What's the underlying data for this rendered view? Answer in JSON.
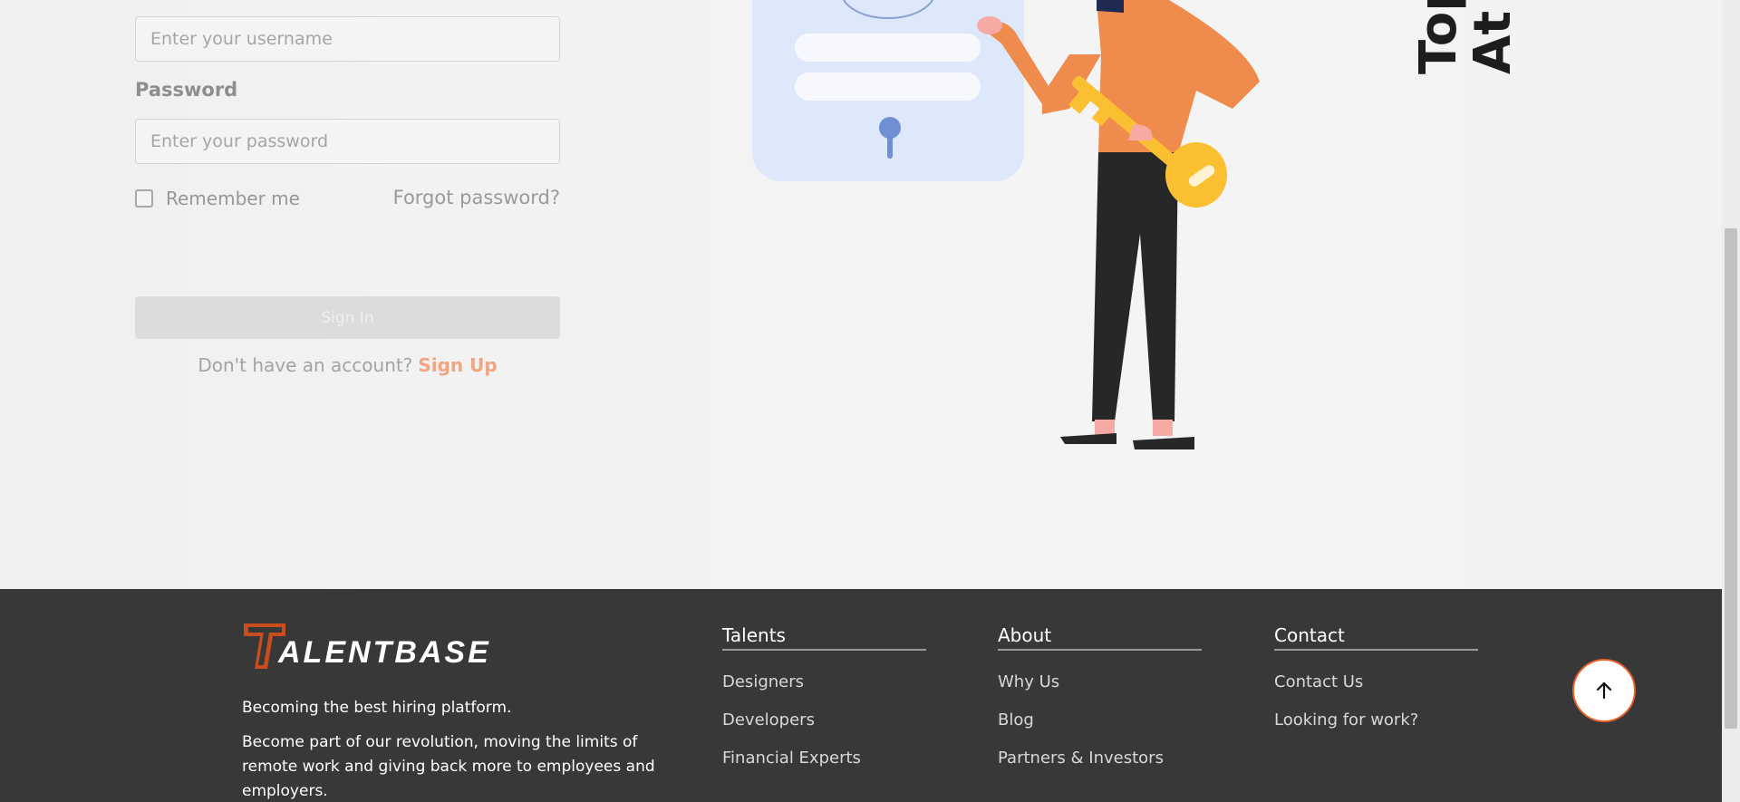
{
  "login_form": {
    "username_placeholder": "Enter your username",
    "password_label": "Password",
    "password_placeholder": "Enter your password",
    "remember_label": "Remember me",
    "forgot_label": "Forgot password?",
    "signin_label": "Sign In",
    "no_account_text": "Don't have an account?",
    "signup_label": "Sign Up"
  },
  "hero": {
    "headline": "Top\nAt C"
  },
  "footer": {
    "logo_text": "ALENTBASE",
    "tagline": "Becoming the best hiring platform.",
    "blurb": "Become part of our revolution, moving the limits of remote work and giving back more to employees and employers.",
    "columns": [
      {
        "title": "Talents",
        "links": [
          "Designers",
          "Developers",
          "Financial Experts"
        ]
      },
      {
        "title": "About",
        "links": [
          "Why Us",
          "Blog",
          "Partners & Investors"
        ]
      },
      {
        "title": "Contact",
        "links": [
          "Contact Us",
          "Looking for work?"
        ]
      }
    ],
    "scroll_top_icon": "arrow-up-icon"
  },
  "colors": {
    "accent": "#e8622a",
    "signup_link": "#f0a583",
    "footer_bg": "#383838",
    "character_top": "#ef8b4c",
    "key": "#fbbf32"
  }
}
